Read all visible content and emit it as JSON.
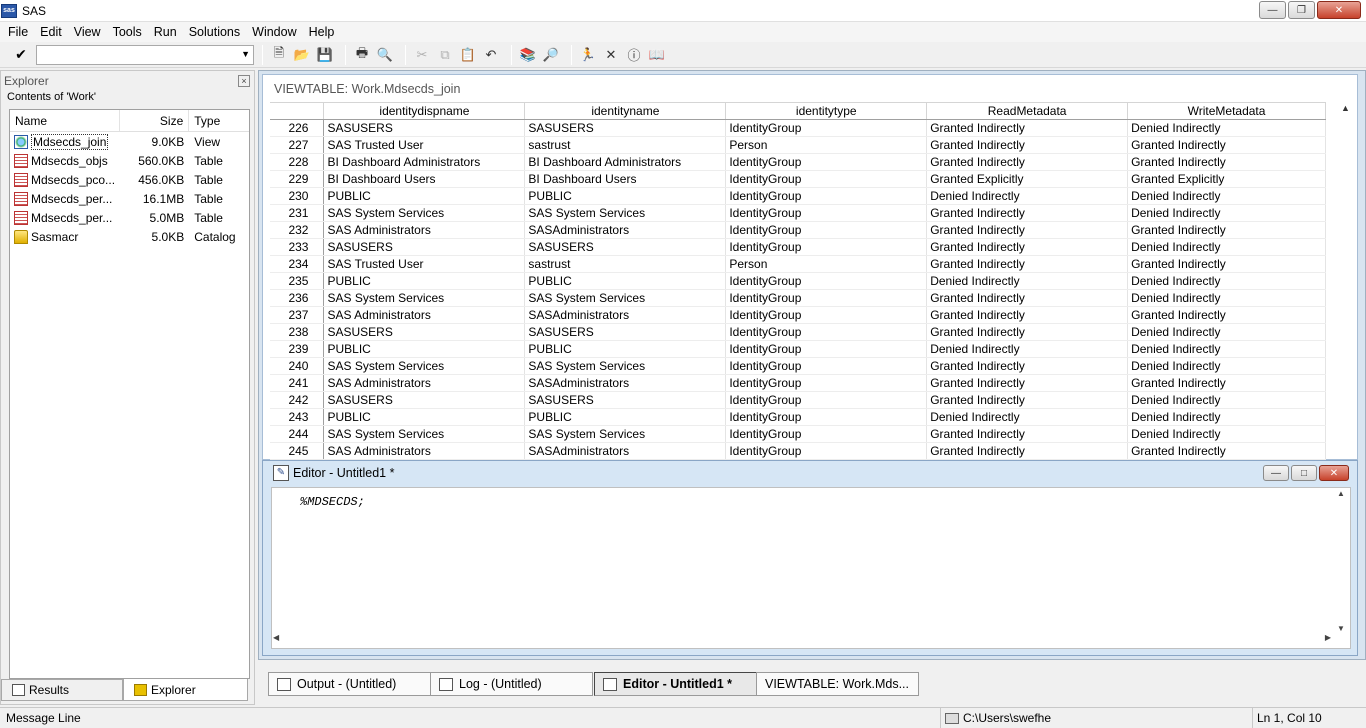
{
  "app": {
    "title": "SAS",
    "icon_text": "sas"
  },
  "menu": [
    "File",
    "Edit",
    "View",
    "Tools",
    "Run",
    "Solutions",
    "Window",
    "Help"
  ],
  "toolbar": {
    "command_value": ""
  },
  "explorer": {
    "title": "Explorer",
    "subtitle": "Contents of 'Work'",
    "columns": {
      "name": "Name",
      "size": "Size",
      "type": "Type"
    },
    "items": [
      {
        "name": "Mdsecds_join",
        "size": "9.0KB",
        "type": "View"
      },
      {
        "name": "Mdsecds_objs",
        "size": "560.0KB",
        "type": "Table"
      },
      {
        "name": "Mdsecds_pco...",
        "size": "456.0KB",
        "type": "Table"
      },
      {
        "name": "Mdsecds_per...",
        "size": "16.1MB",
        "type": "Table"
      },
      {
        "name": "Mdsecds_per...",
        "size": "5.0MB",
        "type": "Table"
      },
      {
        "name": "Sasmacr",
        "size": "5.0KB",
        "type": "Catalog"
      }
    ],
    "tabs": {
      "results": "Results",
      "explorer": "Explorer"
    }
  },
  "viewtable": {
    "title": "VIEWTABLE: Work.Mdsecds_join",
    "columns": [
      "identitydispname",
      "identityname",
      "identitytype",
      "ReadMetadata",
      "WriteMetadata"
    ],
    "rows": [
      [
        "226",
        "SASUSERS",
        "SASUSERS",
        "IdentityGroup",
        "Granted Indirectly",
        "Denied Indirectly"
      ],
      [
        "227",
        "SAS Trusted User",
        "sastrust",
        "Person",
        "Granted Indirectly",
        "Granted Indirectly"
      ],
      [
        "228",
        "BI Dashboard Administrators",
        "BI Dashboard Administrators",
        "IdentityGroup",
        "Granted Indirectly",
        "Granted Indirectly"
      ],
      [
        "229",
        "BI Dashboard Users",
        "BI Dashboard Users",
        "IdentityGroup",
        "Granted Explicitly",
        "Granted Explicitly"
      ],
      [
        "230",
        "PUBLIC",
        "PUBLIC",
        "IdentityGroup",
        "Denied Indirectly",
        "Denied Indirectly"
      ],
      [
        "231",
        "SAS System Services",
        "SAS System Services",
        "IdentityGroup",
        "Granted Indirectly",
        "Denied Indirectly"
      ],
      [
        "232",
        "SAS Administrators",
        "SASAdministrators",
        "IdentityGroup",
        "Granted Indirectly",
        "Granted Indirectly"
      ],
      [
        "233",
        "SASUSERS",
        "SASUSERS",
        "IdentityGroup",
        "Granted Indirectly",
        "Denied Indirectly"
      ],
      [
        "234",
        "SAS Trusted User",
        "sastrust",
        "Person",
        "Granted Indirectly",
        "Granted Indirectly"
      ],
      [
        "235",
        "PUBLIC",
        "PUBLIC",
        "IdentityGroup",
        "Denied Indirectly",
        "Denied Indirectly"
      ],
      [
        "236",
        "SAS System Services",
        "SAS System Services",
        "IdentityGroup",
        "Granted Indirectly",
        "Denied Indirectly"
      ],
      [
        "237",
        "SAS Administrators",
        "SASAdministrators",
        "IdentityGroup",
        "Granted Indirectly",
        "Granted Indirectly"
      ],
      [
        "238",
        "SASUSERS",
        "SASUSERS",
        "IdentityGroup",
        "Granted Indirectly",
        "Denied Indirectly"
      ],
      [
        "239",
        "PUBLIC",
        "PUBLIC",
        "IdentityGroup",
        "Denied Indirectly",
        "Denied Indirectly"
      ],
      [
        "240",
        "SAS System Services",
        "SAS System Services",
        "IdentityGroup",
        "Granted Indirectly",
        "Denied Indirectly"
      ],
      [
        "241",
        "SAS Administrators",
        "SASAdministrators",
        "IdentityGroup",
        "Granted Indirectly",
        "Granted Indirectly"
      ],
      [
        "242",
        "SASUSERS",
        "SASUSERS",
        "IdentityGroup",
        "Granted Indirectly",
        "Denied Indirectly"
      ],
      [
        "243",
        "PUBLIC",
        "PUBLIC",
        "IdentityGroup",
        "Denied Indirectly",
        "Denied Indirectly"
      ],
      [
        "244",
        "SAS System Services",
        "SAS System Services",
        "IdentityGroup",
        "Granted Indirectly",
        "Denied Indirectly"
      ],
      [
        "245",
        "SAS Administrators",
        "SASAdministrators",
        "IdentityGroup",
        "Granted Indirectly",
        "Granted Indirectly"
      ]
    ]
  },
  "editor": {
    "title": "Editor - Untitled1 *",
    "code": "%MDSECDS;"
  },
  "window_tabs": [
    {
      "label": "Output - (Untitled)"
    },
    {
      "label": "Log - (Untitled)"
    },
    {
      "label": "Editor - Untitled1 *"
    },
    {
      "label": "VIEWTABLE: Work.Mds..."
    }
  ],
  "status": {
    "message": "Message Line",
    "path": "C:\\Users\\swefhe",
    "position": "Ln 1, Col 10"
  }
}
